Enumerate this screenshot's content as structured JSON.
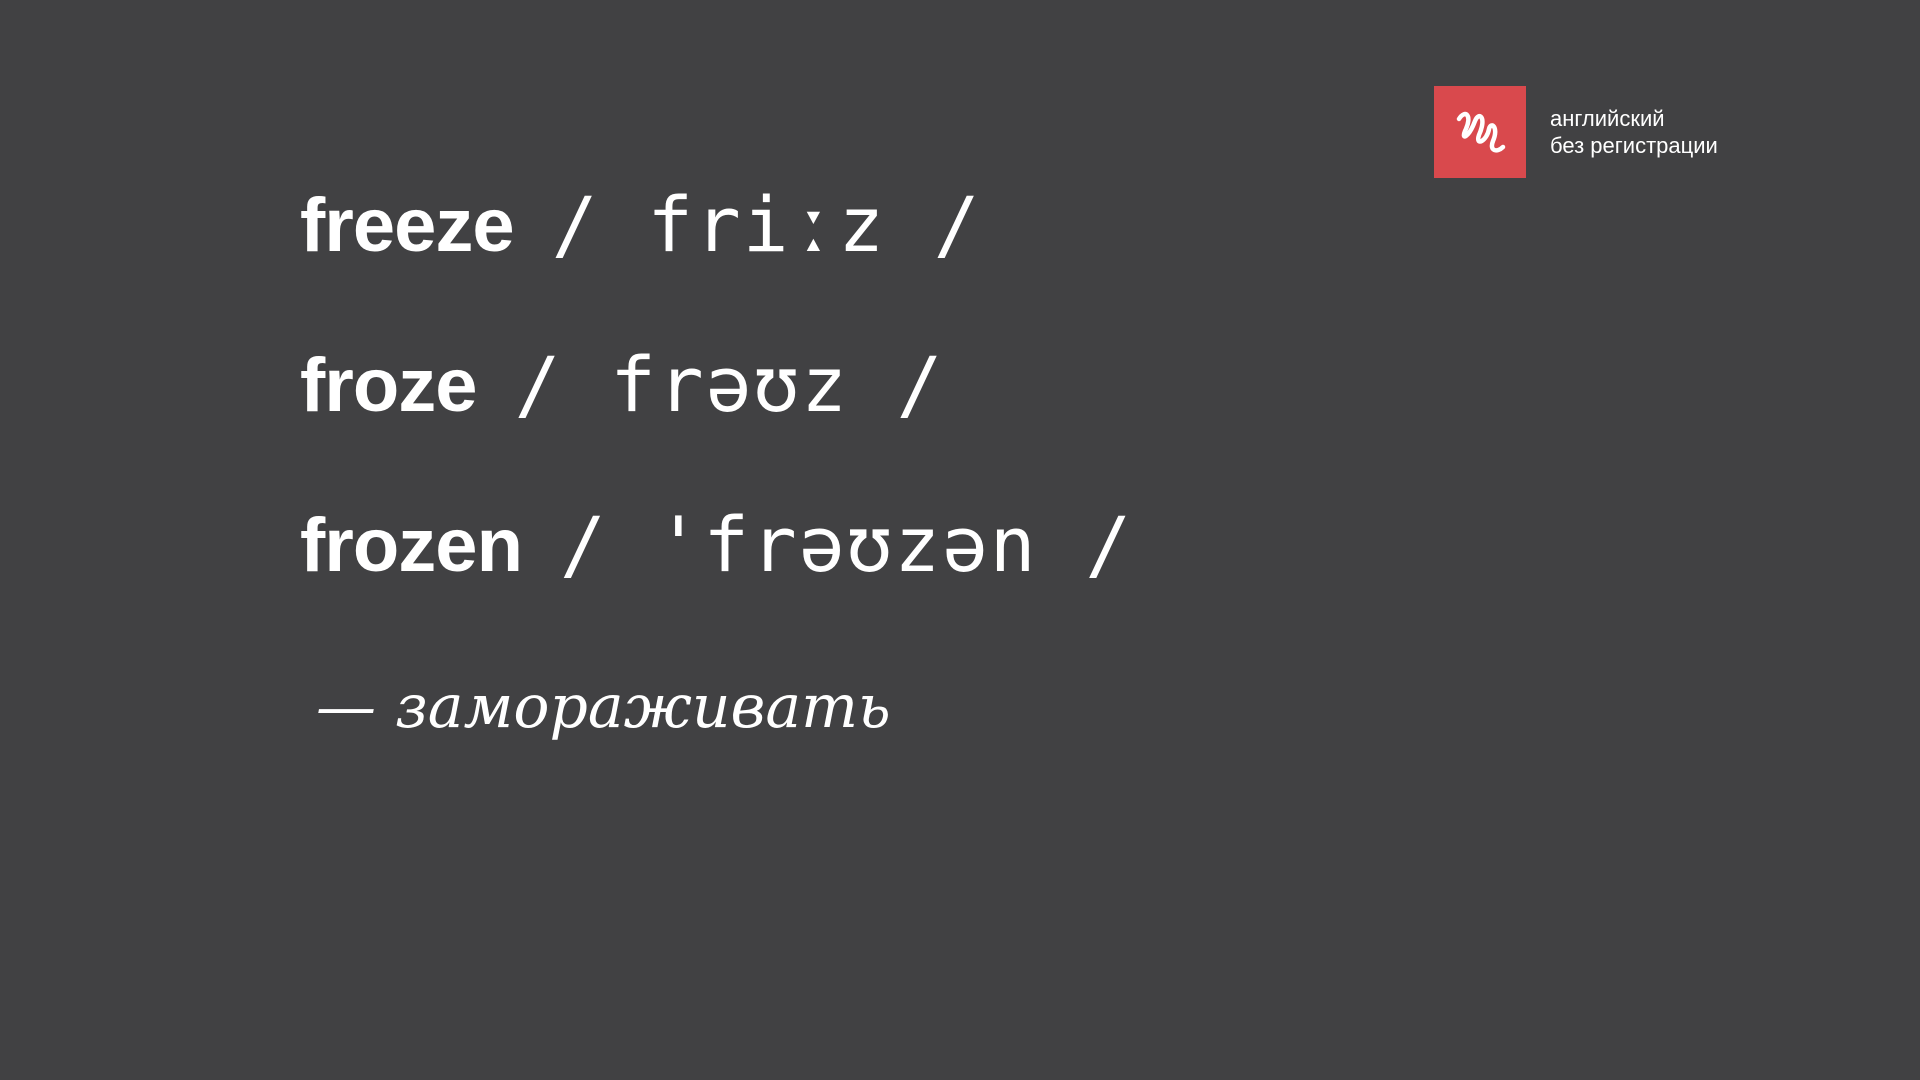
{
  "brand": {
    "line1": "английский",
    "line2": "без регистрации",
    "accent_color": "#d9494d",
    "icon": "squiggle-logo-icon"
  },
  "verbs": [
    {
      "word": "freeze",
      "transcription": "/ friːz /"
    },
    {
      "word": "froze",
      "transcription": "/ frəʊz /"
    },
    {
      "word": "frozen",
      "transcription": "/ 'frəʊzən /"
    }
  ],
  "translation": "— замораживать",
  "colors": {
    "background": "#414143",
    "text": "#ffffff"
  }
}
